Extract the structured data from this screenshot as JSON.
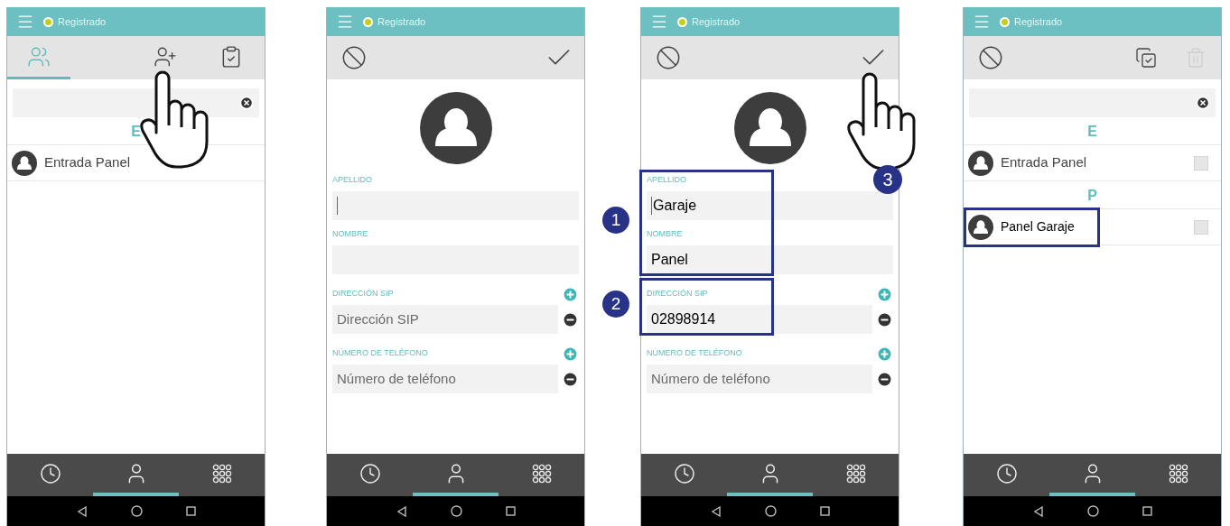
{
  "screens": [
    {
      "status": {
        "label": "Registrado"
      },
      "toolbar": {
        "kind": "tabs",
        "items": [
          {
            "kind": "contacts",
            "selected": true,
            "pointed": false
          },
          {
            "kind": "add-contact",
            "selected": false,
            "pointed": true
          },
          {
            "kind": "edit-list",
            "selected": false,
            "pointed": false
          }
        ]
      },
      "content": {
        "kind": "list",
        "sections": [
          {
            "letter": "E",
            "contacts": [
              {
                "name": "Entrada Panel",
                "highlighted": false
              }
            ]
          }
        ]
      },
      "bottom_nav": [
        {
          "kind": "history",
          "selected": false
        },
        {
          "kind": "contacts",
          "selected": true
        },
        {
          "kind": "keypad",
          "selected": false
        }
      ]
    },
    {
      "status": {
        "label": "Registrado"
      },
      "toolbar": {
        "kind": "actions",
        "items": [
          {
            "kind": "cancel",
            "disabled": false,
            "pointed": false
          },
          {
            "kind": "confirm",
            "disabled": false,
            "pointed": false
          }
        ]
      },
      "content": {
        "kind": "form",
        "groups": [
          {
            "fields": [
              {
                "kind": "text",
                "label": "APELLIDO",
                "cursor": true
              },
              {
                "kind": "text",
                "label": "NOMBRE",
                "cursor": false
              },
              {
                "kind": "multi",
                "label": "DIRECCIÓN SIP",
                "placeholder": "Dirección SIP",
                "cursor": false
              },
              {
                "kind": "multi",
                "label": "NÚMERO DE TELÉFONO",
                "placeholder": "Número de teléfono",
                "cursor": false
              }
            ]
          }
        ]
      },
      "bottom_nav": [
        {
          "kind": "history",
          "selected": false
        },
        {
          "kind": "contacts",
          "selected": true
        },
        {
          "kind": "keypad",
          "selected": false
        }
      ]
    },
    {
      "status": {
        "label": "Registrado"
      },
      "toolbar": {
        "kind": "actions",
        "items": [
          {
            "kind": "cancel",
            "disabled": false,
            "pointed": false
          },
          {
            "kind": "confirm",
            "disabled": false,
            "pointed": true,
            "step": "3"
          }
        ]
      },
      "content": {
        "kind": "form",
        "groups": [
          {
            "callout": "1",
            "fields": [
              {
                "kind": "text",
                "label": "APELLIDO",
                "value": "Garaje",
                "cursor": true
              },
              {
                "kind": "text",
                "label": "NOMBRE",
                "value": "Panel",
                "cursor": false
              }
            ]
          },
          {
            "callout": "2",
            "fields": [
              {
                "kind": "multi",
                "label": "DIRECCIÓN SIP",
                "value": "02898914",
                "cursor": false
              }
            ]
          },
          {
            "fields": [
              {
                "kind": "multi",
                "label": "NÚMERO DE TELÉFONO",
                "placeholder": "Número de teléfono",
                "cursor": false
              }
            ]
          }
        ]
      },
      "bottom_nav": [
        {
          "kind": "history",
          "selected": false
        },
        {
          "kind": "contacts",
          "selected": true
        },
        {
          "kind": "keypad",
          "selected": false
        }
      ]
    },
    {
      "status": {
        "label": "Registrado"
      },
      "toolbar": {
        "kind": "actions",
        "items": [
          {
            "kind": "cancel",
            "disabled": false,
            "pointed": false
          },
          {
            "kind": "select-all",
            "disabled": false,
            "pointed": false
          },
          {
            "kind": "delete",
            "disabled": true,
            "pointed": false
          }
        ]
      },
      "content": {
        "kind": "list",
        "sections": [
          {
            "letter": "E",
            "contacts": [
              {
                "name": "Entrada Panel",
                "highlighted": false,
                "checked": false
              }
            ]
          },
          {
            "letter": "P",
            "contacts": [
              {
                "name": "Panel Garaje",
                "highlighted": true,
                "checked": false
              }
            ]
          }
        ]
      },
      "bottom_nav": [
        {
          "kind": "history",
          "selected": false
        },
        {
          "kind": "contacts",
          "selected": true
        },
        {
          "kind": "keypad",
          "selected": false
        }
      ]
    }
  ]
}
